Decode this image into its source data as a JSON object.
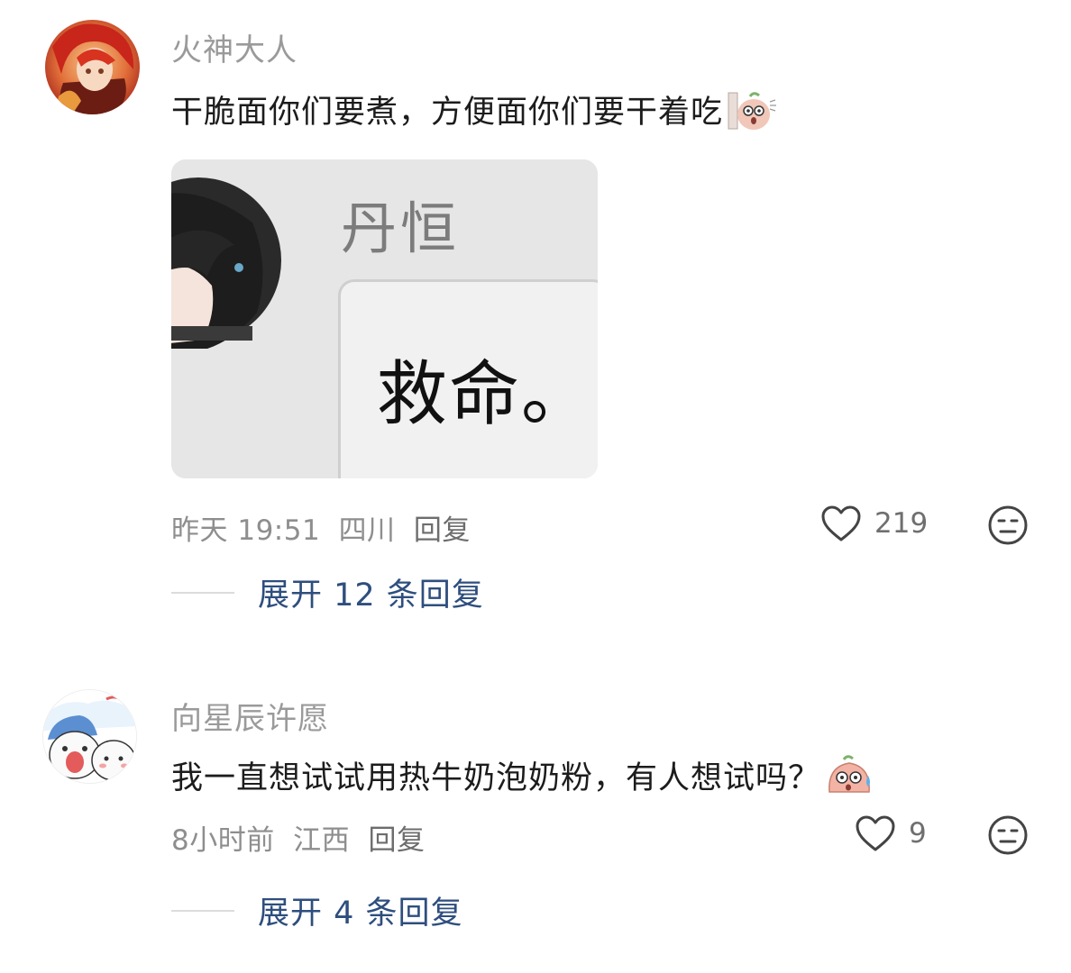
{
  "comments": [
    {
      "username": "火神大人",
      "text": "干脆面你们要煮，方便面你们要干着吃",
      "emoji_icon": "peeking-creature-icon",
      "image": {
        "name_text": "丹恒",
        "bubble_text": "救命。"
      },
      "time": "昨天 19:51",
      "location": "四川",
      "reply_label": "回复",
      "likes": "219",
      "expand_label": "展开 12 条回复"
    },
    {
      "username": "向星辰许愿",
      "text": "我一直想试试用热牛奶泡奶粉，有人想试吗？",
      "emoji_icon": "sweating-creature-icon",
      "time": "8小时前",
      "location": "江西",
      "reply_label": "回复",
      "likes": "9",
      "expand_label": "展开 4 条回复"
    }
  ],
  "colors": {
    "accent_link": "#2e4e7e",
    "meta_gray": "#8e8e8e",
    "username_gray": "#9a9a9a"
  }
}
